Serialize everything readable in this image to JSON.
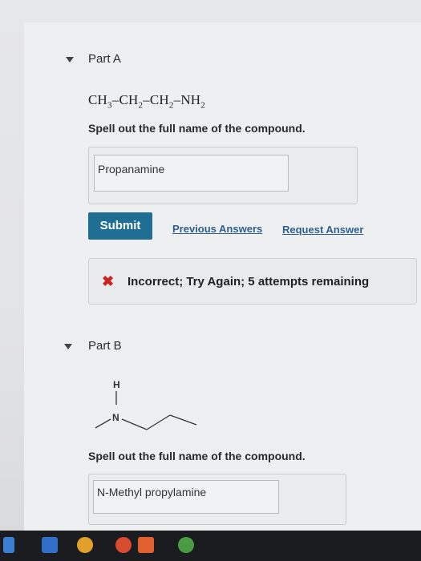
{
  "partA": {
    "title": "Part A",
    "formula": {
      "ch3": "CH",
      "ch3_sub": "3",
      "dash1": "–",
      "ch2a": "CH",
      "ch2a_sub": "2",
      "dash2": "–",
      "ch2b": "CH",
      "ch2b_sub": "2",
      "dash3": "–",
      "nh2": "NH",
      "nh2_sub": "2"
    },
    "prompt": "Spell out the full name of the compound.",
    "answer_value": "Propanamine",
    "submit_label": "Submit",
    "previous_answers_label": "Previous Answers",
    "request_answer_label": "Request Answer",
    "feedback_text": "Incorrect; Try Again; 5 attempts remaining",
    "feedback_icon": "✖"
  },
  "partB": {
    "title": "Part B",
    "structure_labels": {
      "h": "H",
      "n": "N"
    },
    "prompt": "Spell out the full name of the compound.",
    "answer_value": "N-Methyl propylamine"
  },
  "colors": {
    "submit": "#1f6f95",
    "link": "#2f5f8c",
    "error": "#cc2222"
  },
  "taskbar_icons": [
    "windows-start-icon",
    "mail-icon",
    "explorer-icon",
    "chrome-icon",
    "office-icon",
    "chrome-icon"
  ]
}
